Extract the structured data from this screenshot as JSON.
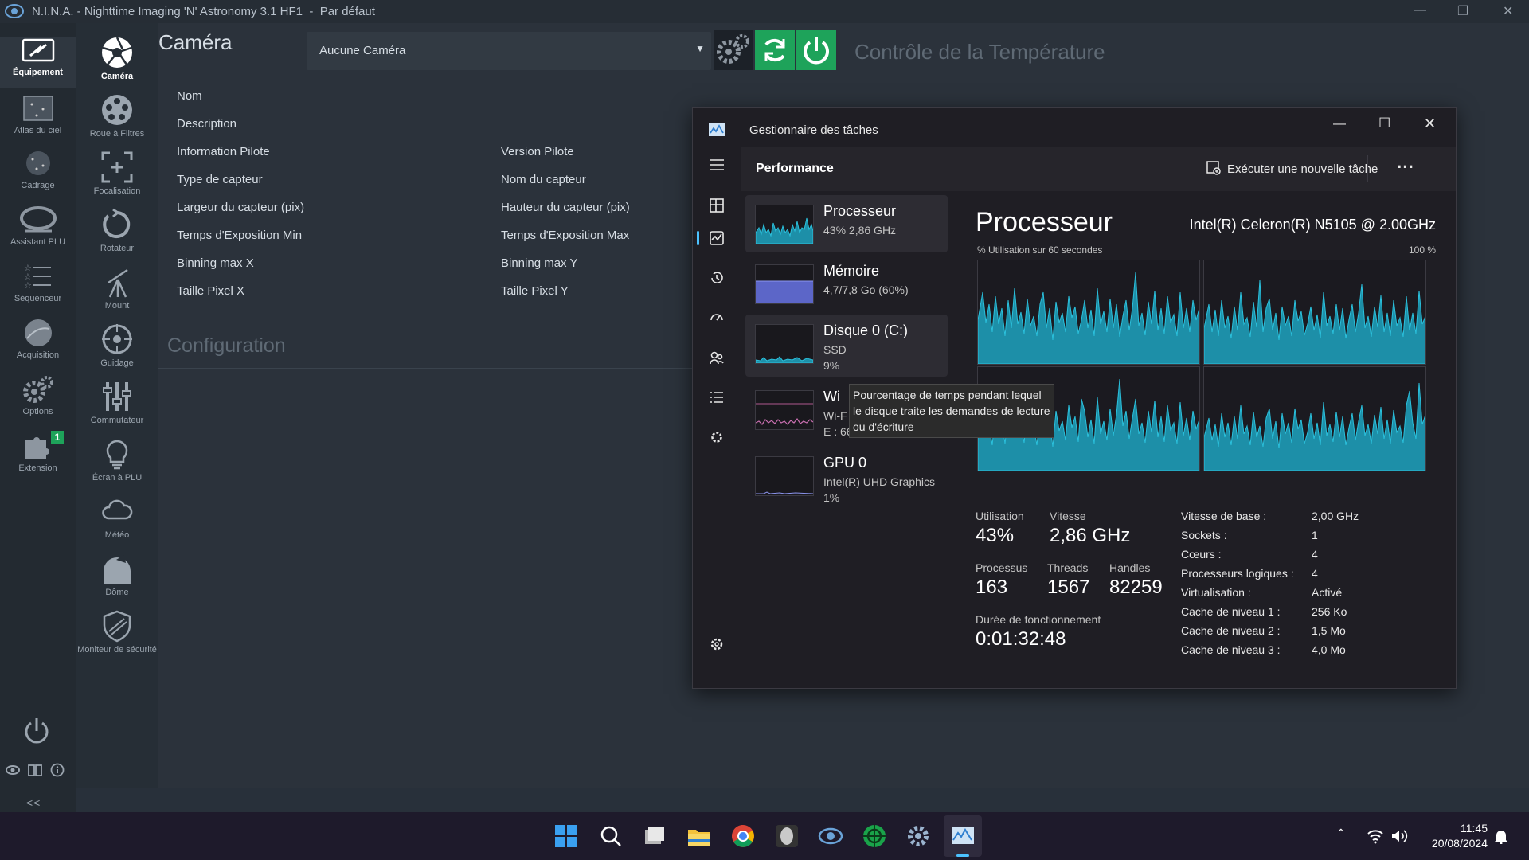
{
  "window": {
    "title": "N.I.N.A. - Nighttime Imaging 'N' Astronomy 3.1 HF1",
    "profile": "Par défaut"
  },
  "sidebar": {
    "items": [
      {
        "label": "Équipement",
        "icon": "equipment-icon",
        "active": true
      },
      {
        "label": "Atlas du ciel",
        "icon": "sky-atlas-icon"
      },
      {
        "label": "Cadrage",
        "icon": "framing-icon"
      },
      {
        "label": "Assistant PLU",
        "icon": "flat-wizard-icon"
      },
      {
        "label": "Séquenceur",
        "icon": "sequencer-icon"
      },
      {
        "label": "Acquisition",
        "icon": "imaging-icon"
      },
      {
        "label": "Options",
        "icon": "options-gear-icon"
      },
      {
        "label": "Extension",
        "icon": "plugin-puzzle-icon",
        "badge": "1"
      }
    ],
    "collapse_label": "<<"
  },
  "equipment_nav": {
    "items": [
      {
        "label": "Caméra",
        "icon": "camera-aperture-icon",
        "active": true
      },
      {
        "label": "Roue à Filtres",
        "icon": "filter-wheel-icon"
      },
      {
        "label": "Focalisation",
        "icon": "focuser-icon"
      },
      {
        "label": "Rotateur",
        "icon": "rotator-icon"
      },
      {
        "label": "Mount",
        "icon": "telescope-mount-icon"
      },
      {
        "label": "Guidage",
        "icon": "guider-icon"
      },
      {
        "label": "Commutateur",
        "icon": "switch-sliders-icon"
      },
      {
        "label": "Écran à PLU",
        "icon": "flat-panel-bulb-icon"
      },
      {
        "label": "Météo",
        "icon": "weather-cloud-icon"
      },
      {
        "label": "Dôme",
        "icon": "dome-icon"
      },
      {
        "label": "Moniteur de sécurité",
        "icon": "safety-shield-icon"
      }
    ]
  },
  "camera": {
    "header": "Caméra",
    "selected": "Aucune Caméra",
    "temperature_header": "Contrôle de la Température",
    "properties_left": [
      "Nom",
      "Description",
      "Information Pilote",
      "Type de capteur",
      "Largeur du capteur (pix)",
      "Temps d'Exposition Min",
      "Binning max X",
      "Taille Pixel X"
    ],
    "properties_right": [
      "Version Pilote",
      "Nom du capteur",
      "Hauteur du capteur (pix)",
      "Temps d'Exposition Max",
      "Binning max Y",
      "Taille Pixel Y"
    ],
    "config_header": "Configuration"
  },
  "taskmgr": {
    "title": "Gestionnaire des tâches",
    "section": "Performance",
    "run_task": "Exécuter une nouvelle tâche",
    "more": "···",
    "list": [
      {
        "name": "Processeur",
        "sub1": "43% 2,86 GHz"
      },
      {
        "name": "Mémoire",
        "sub1": "4,7/7,8 Go (60%)"
      },
      {
        "name": "Disque 0 (C:)",
        "sub1": "SSD",
        "sub2": "9%"
      },
      {
        "name": "Wi",
        "sub1": "Wi-F",
        "sub2": "E : 664 R : 0 Kbits/s"
      },
      {
        "name": "GPU 0",
        "sub1": "Intel(R) UHD Graphics",
        "sub2": "1%"
      }
    ],
    "tooltip": "Pourcentage de temps pendant lequel le disque traite les demandes de lecture ou d'écriture",
    "detail": {
      "name": "Processeur",
      "model": "Intel(R) Celeron(R) N5105 @ 2.00GHz",
      "graph_label": "% Utilisation sur 60 secondes",
      "graph_max": "100 %",
      "stats": {
        "utilisation_label": "Utilisation",
        "utilisation": "43%",
        "vitesse_label": "Vitesse",
        "vitesse": "2,86 GHz",
        "processus_label": "Processus",
        "processus": "163",
        "threads_label": "Threads",
        "threads": "1567",
        "handles_label": "Handles",
        "handles": "82259",
        "uptime_label": "Durée de fonctionnement",
        "uptime": "0:01:32:48"
      },
      "specs": [
        {
          "k": "Vitesse de base :",
          "v": "2,00 GHz"
        },
        {
          "k": "Sockets :",
          "v": "1"
        },
        {
          "k": "Cœurs :",
          "v": "4"
        },
        {
          "k": "Processeurs logiques :",
          "v": "4"
        },
        {
          "k": "Virtualisation :",
          "v": "Activé"
        },
        {
          "k": "Cache de niveau 1 :",
          "v": "256 Ko"
        },
        {
          "k": "Cache de niveau 2 :",
          "v": "1,5 Mo"
        },
        {
          "k": "Cache de niveau 3 :",
          "v": "4,0 Mo"
        }
      ]
    }
  },
  "taskbar": {
    "time": "11:45",
    "date": "20/08/2024"
  },
  "colors": {
    "accent_green": "#1ea35a",
    "graph_teal": "#23a5c0",
    "memory_blue": "#6a74d9"
  }
}
